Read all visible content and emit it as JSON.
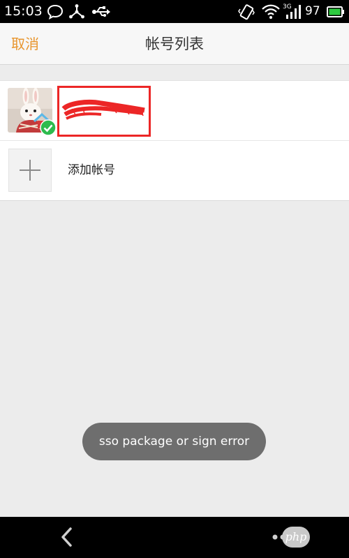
{
  "status_bar": {
    "time": "15:03",
    "battery_level": "97",
    "network_type": "3G",
    "icons": [
      "chat-bubble-icon",
      "share-icon",
      "usb-icon",
      "vibrate-icon",
      "wifi-icon",
      "signal-icon",
      "battery-icon"
    ]
  },
  "header": {
    "cancel_label": "取消",
    "title": "帐号列表"
  },
  "accounts": {
    "current_account": {
      "name_redacted": true,
      "selected": true
    },
    "add_label": "添加帐号"
  },
  "toast": {
    "message": "sso package or sign error"
  },
  "nav_bar": {
    "watermark_text": "php"
  },
  "colors": {
    "accent": "#e8952d",
    "check": "#2dbb4e",
    "redaction": "#ec2626",
    "toast_bg": "#6e6e6e"
  }
}
